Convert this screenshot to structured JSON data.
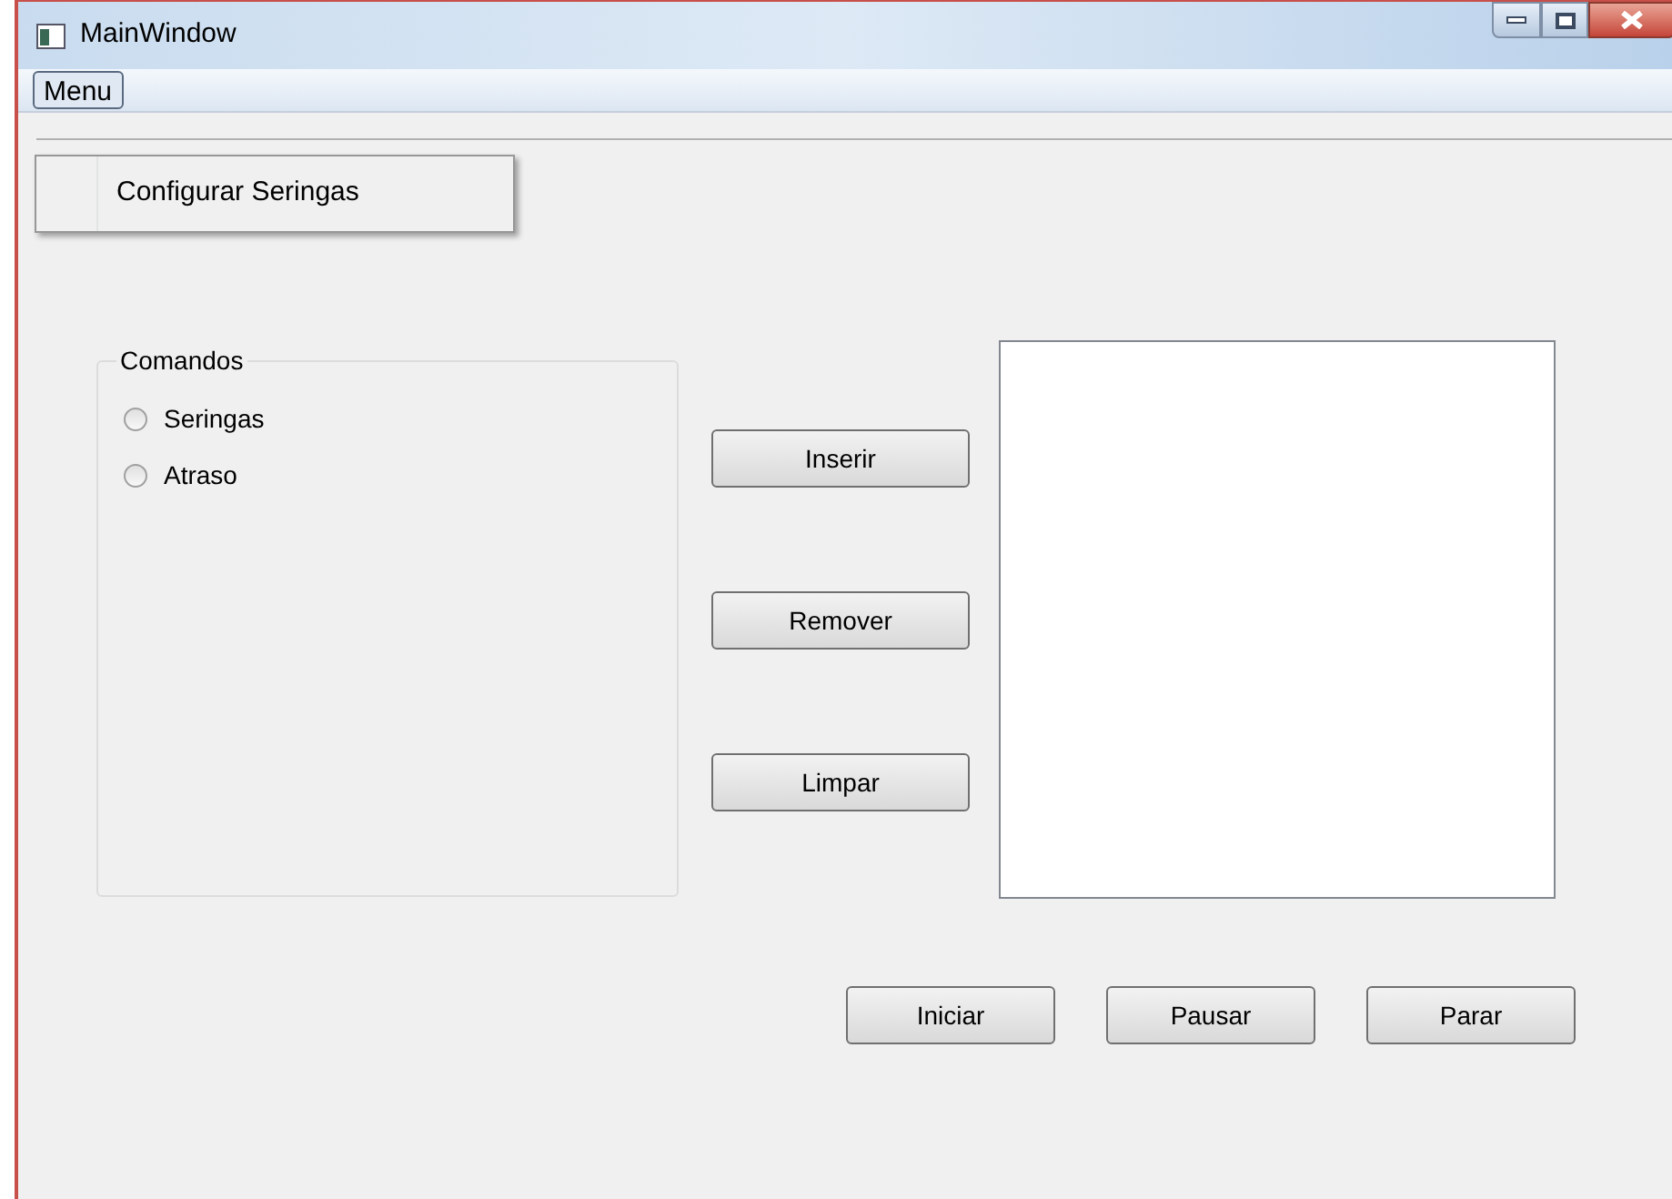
{
  "window": {
    "title": "MainWindow"
  },
  "menu_bar": {
    "items": [
      {
        "label": "Menu",
        "selected": true
      }
    ]
  },
  "menu_dropdown": {
    "items": [
      "Configurar Seringas"
    ]
  },
  "comandos": {
    "title": "Comandos",
    "options": [
      {
        "label": "Seringas",
        "selected": false
      },
      {
        "label": "Atraso",
        "selected": false
      }
    ]
  },
  "side_buttons": [
    "Inserir",
    "Remover",
    "Limpar"
  ],
  "bottom_buttons": [
    "Iniciar",
    "Pausar",
    "Parar"
  ]
}
